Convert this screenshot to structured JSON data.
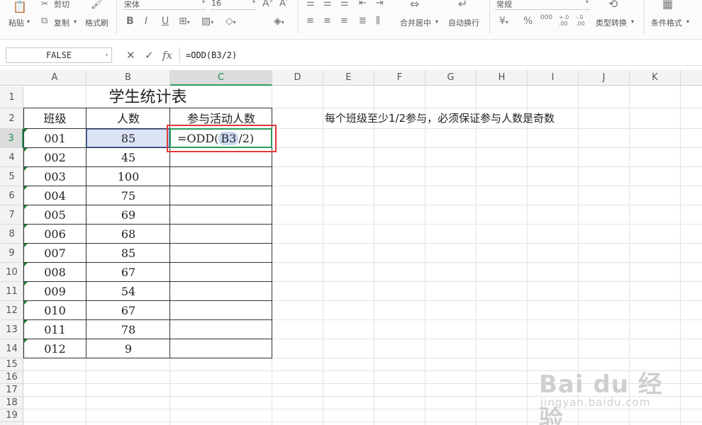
{
  "ribbon": {
    "paste": "粘贴",
    "cut": "剪切",
    "copy": "复制",
    "format_painter": "格式刷",
    "font_name": "宋体",
    "font_size": "16",
    "merge_center": "合并居中",
    "wrap_text": "自动换行",
    "number_format": "常规",
    "type_convert": "类型转换",
    "conditional_format": "条件格式"
  },
  "formula_bar": {
    "name_box": "FALSE",
    "fx_label": "fx",
    "formula": "=ODD(B3/2)"
  },
  "columns": [
    "A",
    "B",
    "C",
    "D",
    "E",
    "F",
    "G",
    "H",
    "I",
    "J",
    "K"
  ],
  "rows": [
    "1",
    "2",
    "3",
    "4",
    "5",
    "6",
    "7",
    "8",
    "9",
    "10",
    "11",
    "12",
    "13",
    "14",
    "15",
    "16",
    "17",
    "18",
    "19"
  ],
  "sheet": {
    "title": "学生统计表",
    "headers": [
      "班级",
      "人数",
      "参与活动人数"
    ],
    "data": [
      {
        "cls": "001",
        "count": "85"
      },
      {
        "cls": "002",
        "count": "45"
      },
      {
        "cls": "003",
        "count": "100"
      },
      {
        "cls": "004",
        "count": "75"
      },
      {
        "cls": "005",
        "count": "69"
      },
      {
        "cls": "006",
        "count": "68"
      },
      {
        "cls": "007",
        "count": "85"
      },
      {
        "cls": "008",
        "count": "67"
      },
      {
        "cls": "009",
        "count": "54"
      },
      {
        "cls": "010",
        "count": "67"
      },
      {
        "cls": "011",
        "count": "78"
      },
      {
        "cls": "012",
        "count": "9"
      }
    ],
    "editing": {
      "prefix": "=ODD(",
      "ref": "B3",
      "suffix": "/2)"
    },
    "note": "每个班级至少1/2参与，必须保证参与人数是奇数"
  },
  "watermark": {
    "logo": "Bai du 经验",
    "url": "jingyan.baidu.com"
  },
  "colors": {
    "accent": "#2e9a5a",
    "selection": "#dbe3f5",
    "highlight": "#e03a3a"
  }
}
